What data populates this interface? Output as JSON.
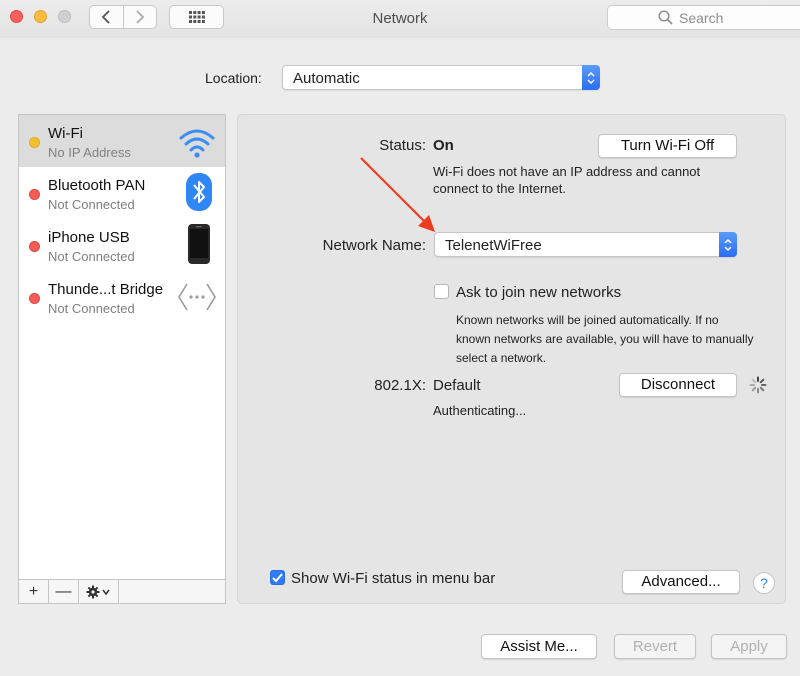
{
  "window": {
    "title": "Network",
    "search_placeholder": "Search"
  },
  "location": {
    "label": "Location:",
    "value": "Automatic"
  },
  "sidebar": {
    "services": [
      {
        "name": "Wi-Fi",
        "status": "No IP Address",
        "status_color": "#f5bf2e",
        "icon": "wifi-icon"
      },
      {
        "name": "Bluetooth PAN",
        "status": "Not Connected",
        "status_color": "#f45c56",
        "icon": "bluetooth-icon"
      },
      {
        "name": "iPhone USB",
        "status": "Not Connected",
        "status_color": "#f45c56",
        "icon": "iphone-icon"
      },
      {
        "name": "Thunde...t Bridge",
        "status": "Not Connected",
        "status_color": "#f45c56",
        "icon": "thunderbolt-bridge-icon"
      }
    ],
    "footer": {
      "add": "+",
      "remove": "—"
    }
  },
  "detail": {
    "status_label": "Status:",
    "status_value": "On",
    "turn_off_button": "Turn Wi-Fi Off",
    "status_description": "Wi-Fi does not have an IP address and cannot connect to the Internet.",
    "network_name_label": "Network Name:",
    "network_name_value": "TelenetWiFree",
    "ask_join_label": "Ask to join new networks",
    "ask_join_checked": false,
    "ask_join_help": "Known networks will be joined automatically. If no known networks are available, you will have to manually select a network.",
    "dot1x_label": "802.1X:",
    "dot1x_value": "Default",
    "disconnect_button": "Disconnect",
    "dot1x_status": "Authenticating...",
    "show_status_label": "Show Wi-Fi status in menu bar",
    "show_status_checked": true,
    "advanced_button": "Advanced...",
    "help_button": "?"
  },
  "bottom": {
    "assist_button": "Assist Me...",
    "revert_button": "Revert",
    "apply_button": "Apply"
  },
  "colors": {
    "accent": "#2f7cf6",
    "annotation_arrow": "#ee3c20"
  }
}
